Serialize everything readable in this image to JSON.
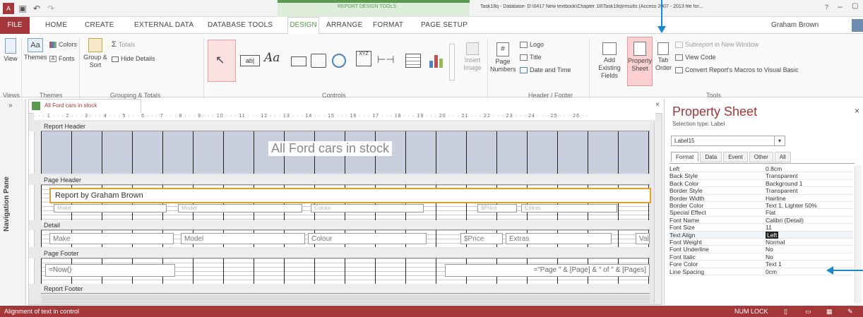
{
  "titlebar": {
    "context_title": "REPORT DESIGN TOOLS",
    "window_title": "Task18q - Database- D:\\0417 New textbook\\Chapter 18\\Task18q\\results (Access 2007 - 2013 file for...",
    "help": "?",
    "user": "Graham Brown"
  },
  "tabs": [
    "FILE",
    "HOME",
    "CREATE",
    "EXTERNAL DATA",
    "DATABASE TOOLS",
    "DESIGN",
    "ARRANGE",
    "FORMAT",
    "PAGE SETUP"
  ],
  "ribbon": {
    "views": {
      "view": "View",
      "label": "Views"
    },
    "themes": {
      "themes": "Themes",
      "colors": "Colors",
      "fonts": "Fonts",
      "label": "Themes"
    },
    "grouping": {
      "group_sort": "Group & Sort",
      "totals": "Totals",
      "hide_details": "Hide Details",
      "label": "Grouping & Totals"
    },
    "controls": {
      "label": "Controls",
      "insert_image": "Insert Image",
      "aa": "Aa",
      "xyz": "XYZ",
      "ab": "ab|"
    },
    "header_footer": {
      "page_numbers": "Page Numbers",
      "logo": "Logo",
      "title": "Title",
      "date_time": "Date and Time",
      "label": "Header / Footer"
    },
    "tools": {
      "add_fields": "Add Existing Fields",
      "property_sheet": "Property Sheet",
      "tab_order": "Tab Order",
      "subreport": "Subreport in New Window",
      "view_code": "View Code",
      "convert_macros": "Convert Report's Macros to Visual Basic",
      "label": "Tools"
    }
  },
  "nav_pane": {
    "label": "Navigation Pane"
  },
  "document": {
    "tab_label": "All Ford cars in stock",
    "ruler": "· · · 1 · · · 2 · · · 3 · · · 4 · · · 5 · · · 6 · · · 7 · · · 8 · · · 9 · · · 10 · · · 11 · · · 12 · · · 13 · · · 14 · · · 15 · · · 16 · · · 17 · · · 18 · · · 19 · · · 20 · · · 21 · · · 22 · · · 23 · · · 24 · · · 25 · · · 26 · ·",
    "sections": {
      "report_header": "Report Header",
      "page_header": "Page Header",
      "detail": "Detail",
      "page_footer": "Page Footer",
      "report_footer": "Report Footer"
    },
    "report_title": "All Ford cars in stock",
    "page_header_label": "Report by Graham Brown",
    "header_fields": [
      "Make",
      "Model",
      "Colour",
      "$Price",
      "Extras"
    ],
    "detail_fields": [
      "Make",
      "Model",
      "Colour",
      "$Price",
      "Extras",
      "Val"
    ],
    "footer_now": "=Now()",
    "footer_page": "=\"Page \" & [Page] & \" of \" & [Pages]"
  },
  "property_sheet": {
    "title": "Property Sheet",
    "selection_type": "Selection type:  Label",
    "selected_object": "Label15",
    "tabs": [
      "Format",
      "Data",
      "Event",
      "Other",
      "All"
    ],
    "rows": [
      {
        "name": "Left",
        "value": "0.8cm"
      },
      {
        "name": "Back Style",
        "value": "Transparent"
      },
      {
        "name": "Back Color",
        "value": "Background 1"
      },
      {
        "name": "Border Style",
        "value": "Transparent"
      },
      {
        "name": "Border Width",
        "value": "Hairline"
      },
      {
        "name": "Border Color",
        "value": "Text 1, Lighter 50%"
      },
      {
        "name": "Special Effect",
        "value": "Flat"
      },
      {
        "name": "Font Name",
        "value": "Calibri (Detail)"
      },
      {
        "name": "Font Size",
        "value": "11"
      },
      {
        "name": "Text Align",
        "value": "Left"
      },
      {
        "name": "Font Weight",
        "value": "Normal"
      },
      {
        "name": "Font Underline",
        "value": "No"
      },
      {
        "name": "Font Italic",
        "value": "No"
      },
      {
        "name": "Fore Color",
        "value": "Text 1"
      },
      {
        "name": "Line Spacing",
        "value": "0cm"
      }
    ]
  },
  "status_bar": {
    "message": "Alignment of text in control",
    "num_lock": "NUM LOCK"
  },
  "colors": {
    "accent": "#a4373a",
    "context": "#5a9a4e",
    "arrow": "#1a88c9"
  }
}
